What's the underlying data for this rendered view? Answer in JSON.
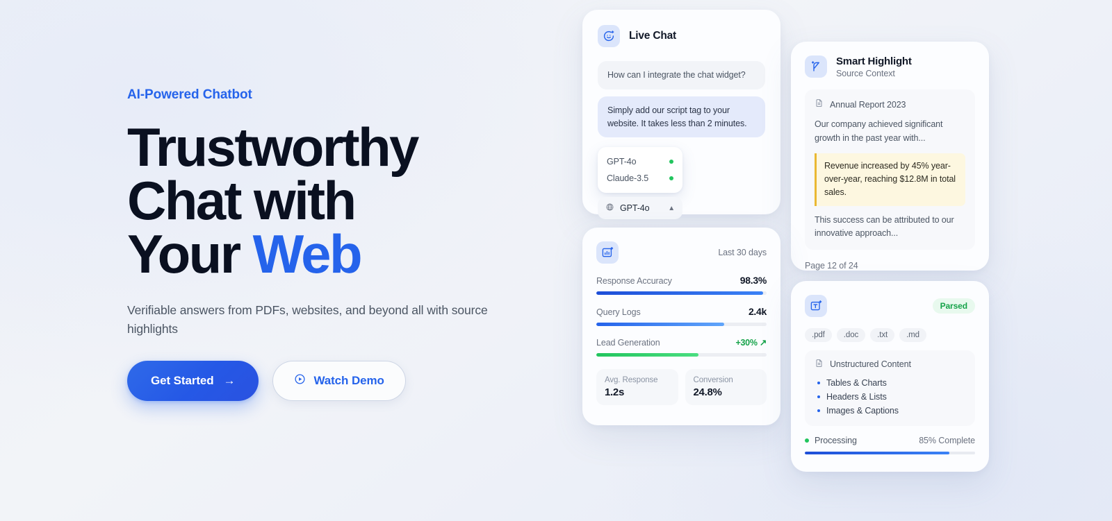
{
  "theme": {
    "accent": "#2563eb",
    "accent_dark": "#1d4ed8",
    "success": "#16a34a",
    "highlight_bg": "#fdf7e0",
    "highlight_border": "#eab832",
    "page_bg": "#edf0f6"
  },
  "hero": {
    "eyebrow": "AI-Powered Chatbot",
    "headline_line1": "Trustworthy",
    "headline_line2": "Chat with",
    "headline_line3_plain": "Your ",
    "headline_line3_accent": "Web",
    "subhead": "Verifiable answers from PDFs, websites, and beyond all with source highlights",
    "primary_cta": "Get Started",
    "primary_cta_icon": "arrow-right-icon",
    "secondary_cta": "Watch Demo",
    "secondary_cta_icon": "play-circle-icon"
  },
  "live_chat_card": {
    "icon": "chat-sparkle-icon",
    "title": "Live Chat",
    "question": "How can I integrate the chat widget?",
    "answer": "Simply add our script tag to your website. It takes less than 2 minutes.",
    "model_options": [
      {
        "name": "GPT-4o",
        "status": "online"
      },
      {
        "name": "Claude-3.5",
        "status": "online"
      }
    ],
    "selected_model": "GPT-4o",
    "selected_model_icon": "openai-logo-icon",
    "chevron": "chevron-up-icon"
  },
  "smart_highlight_card": {
    "icon": "highlighter-sparkle-icon",
    "title": "Smart Highlight",
    "subtitle": "Source Context",
    "document_icon": "document-icon",
    "document_name": "Annual Report 2023",
    "paragraph_before": "Our company achieved significant growth in the past year with...",
    "highlighted_text": "Revenue increased by 45% year-over-year, reaching $12.8M in total sales.",
    "paragraph_after": "This success can be attributed to our innovative approach...",
    "page_indicator": "Page 12 of 24"
  },
  "stats_card": {
    "icon": "chart-sparkle-icon",
    "period": "Last 30 days",
    "metrics": [
      {
        "label": "Response Accuracy",
        "value": "98.3%",
        "percent": 98,
        "color": "blue",
        "positive": false
      },
      {
        "label": "Query Logs",
        "value": "2.4k",
        "percent": 75,
        "color": "blue2",
        "positive": false
      },
      {
        "label": "Lead Generation",
        "value": "+30% ↗",
        "percent": 60,
        "color": "green",
        "positive": true
      }
    ],
    "kpis": [
      {
        "label": "Avg. Response",
        "value": "1.2s"
      },
      {
        "label": "Conversion",
        "value": "24.8%"
      }
    ]
  },
  "parsed_card": {
    "icon": "text-extract-sparkle-icon",
    "badge": "Parsed",
    "file_types": [
      ".pdf",
      ".doc",
      ".txt",
      ".md"
    ],
    "section_icon": "document-icon",
    "section_title": "Unstructured Content",
    "items": [
      "Tables & Charts",
      "Headers & Lists",
      "Images & Captions"
    ],
    "status_label": "Processing",
    "status_color": "#22c55e",
    "progress_text": "85% Complete",
    "progress_percent": 85
  },
  "chart_data": {
    "type": "bar",
    "title": "Last 30 days",
    "categories": [
      "Response Accuracy",
      "Query Logs",
      "Lead Generation"
    ],
    "values": [
      98,
      75,
      60
    ],
    "display_values": [
      "98.3%",
      "2.4k",
      "+30%"
    ],
    "series": [
      {
        "name": "Response Accuracy",
        "value": 98.3,
        "unit": "%",
        "bar_percent": 98,
        "color": "#1d4ed8"
      },
      {
        "name": "Query Logs",
        "value": 2400,
        "unit": "count",
        "bar_percent": 75,
        "color": "#2563eb"
      },
      {
        "name": "Lead Generation",
        "value": 30,
        "unit": "% change",
        "bar_percent": 60,
        "color": "#22c55e"
      }
    ],
    "secondary_metrics": [
      {
        "name": "Avg. Response",
        "value": 1.2,
        "unit": "s"
      },
      {
        "name": "Conversion",
        "value": 24.8,
        "unit": "%"
      }
    ],
    "progress": {
      "name": "Processing",
      "value": 85,
      "unit": "%",
      "label": "85% Complete"
    },
    "xlabel": "",
    "ylabel": "",
    "ylim": [
      0,
      100
    ],
    "grid": false,
    "legend": "none"
  }
}
